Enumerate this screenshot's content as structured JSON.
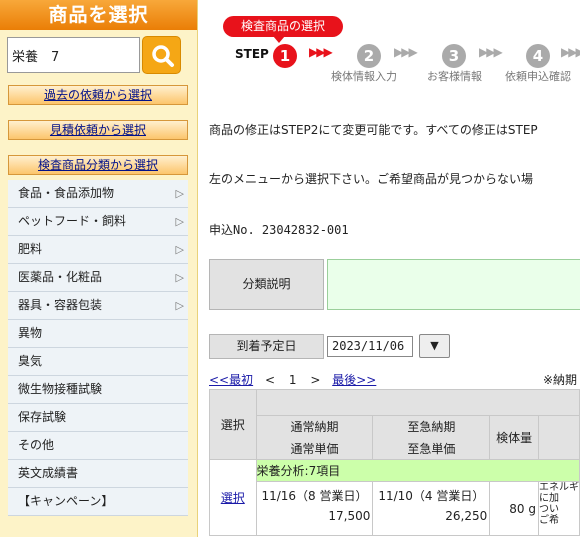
{
  "sidebar": {
    "title": "商品を選択",
    "search": {
      "value": "栄養　7"
    },
    "buttons": [
      "過去の依頼から選択",
      "見積依頼から選択",
      "検査商品分類から選択"
    ],
    "menu": [
      {
        "label": "食品・食品添加物",
        "arrow": "▷"
      },
      {
        "label": "ペットフード・飼料",
        "arrow": "▷"
      },
      {
        "label": "肥料",
        "arrow": "▷"
      },
      {
        "label": "医薬品・化粧品",
        "arrow": "▷"
      },
      {
        "label": "器具・容器包装",
        "arrow": "▷"
      },
      {
        "label": "異物",
        "arrow": ""
      },
      {
        "label": "臭気",
        "arrow": ""
      },
      {
        "label": "微生物接種試験",
        "arrow": ""
      },
      {
        "label": "保存試験",
        "arrow": ""
      },
      {
        "label": "その他",
        "arrow": ""
      },
      {
        "label": "英文成績書",
        "arrow": ""
      },
      {
        "label": "【キャンペーン】",
        "arrow": ""
      }
    ]
  },
  "steps": {
    "badge": "検査商品の選択",
    "label": "STEP",
    "arrow": "▶▶▶",
    "items": [
      {
        "num": "1",
        "caption": ""
      },
      {
        "num": "2",
        "caption": "検体情報入力"
      },
      {
        "num": "3",
        "caption": "お客様情報"
      },
      {
        "num": "4",
        "caption": "依頼申込確認"
      }
    ]
  },
  "main": {
    "notice1": "商品の修正はSTEP2にて変更可能です。すべての修正はSTEP",
    "notice2": "左のメニューから選択下さい。ご希望商品が見つからない場",
    "order_no": "申込No. 23042832-001",
    "category_label": "分類説明",
    "arrival_label": "到着予定日",
    "arrival_date": "2023/11/06",
    "dropdown_glyph": "▼",
    "pager": {
      "first": "<<最初",
      "prev": "<",
      "page": "1",
      "next": ">",
      "last": "最後>>"
    },
    "note": "※納期"
  },
  "table": {
    "headers": {
      "select": "選択",
      "normal_period": "通常納期",
      "normal_price": "通常単価",
      "rush_period": "至急納期",
      "rush_price": "至急単価",
      "sample": "検体量"
    },
    "group": "栄養分析:7項目",
    "row": {
      "select": "選択",
      "normal_period": "11/16（8 営業日）",
      "normal_price": "17,500",
      "rush_period": "11/10（4 営業日）",
      "rush_price": "26,250",
      "sample": "80 g",
      "desc": "エネルギ\nに加\nつい\nご希"
    }
  },
  "colors": {
    "accent": "#ea7e06",
    "step_active": "#e8121b",
    "step_inactive": "#aaaaaa"
  }
}
